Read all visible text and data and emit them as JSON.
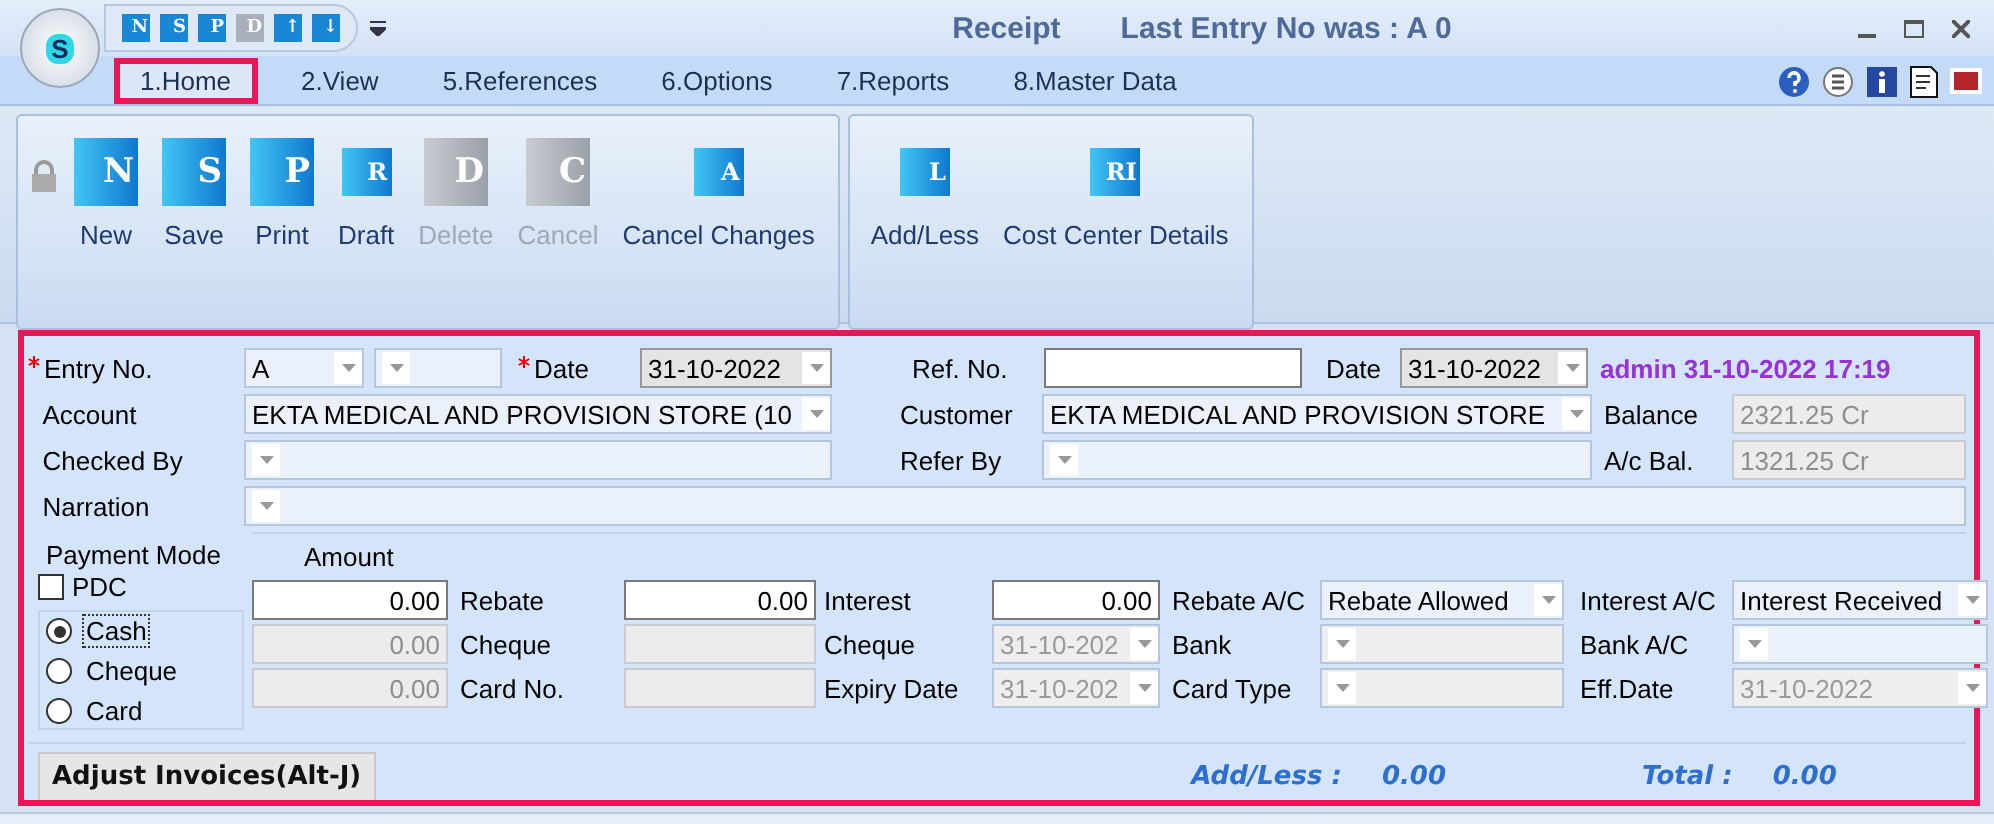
{
  "window": {
    "title": "Receipt",
    "subtitle": "Last Entry No was : A 0",
    "logo_glyph": "S"
  },
  "quick_access": [
    {
      "glyph": "N",
      "disabled": false
    },
    {
      "glyph": "S",
      "disabled": false
    },
    {
      "glyph": "P",
      "disabled": false
    },
    {
      "glyph": "D",
      "disabled": true
    },
    {
      "glyph": "↑",
      "disabled": false
    },
    {
      "glyph": "↓",
      "disabled": false
    }
  ],
  "tabs": [
    {
      "label": "1.Home",
      "selected": true
    },
    {
      "label": "2.View",
      "selected": false
    },
    {
      "label": "5.References",
      "selected": false
    },
    {
      "label": "6.Options",
      "selected": false
    },
    {
      "label": "7.Reports",
      "selected": false
    },
    {
      "label": "8.Master Data",
      "selected": false
    }
  ],
  "ribbon": [
    {
      "locked": true,
      "buttons": [
        {
          "label": "New",
          "glyph": "N",
          "kind": "large",
          "disabled": false
        },
        {
          "label": "Save",
          "glyph": "S",
          "kind": "large",
          "disabled": false
        },
        {
          "label": "Print",
          "glyph": "P",
          "kind": "large",
          "disabled": false
        },
        {
          "label": "Draft",
          "glyph": "R",
          "kind": "small",
          "disabled": false
        },
        {
          "label": "Delete",
          "glyph": "D",
          "kind": "large",
          "disabled": true
        },
        {
          "label": "Cancel",
          "glyph": "C",
          "kind": "large",
          "disabled": true
        },
        {
          "label": "Cancel Changes",
          "glyph": "A",
          "kind": "small",
          "disabled": false
        }
      ]
    },
    {
      "locked": false,
      "buttons": [
        {
          "label": "Add/Less",
          "glyph": "L",
          "kind": "small",
          "disabled": false
        },
        {
          "label": "Cost Center Details",
          "glyph": "RI",
          "kind": "small",
          "disabled": false
        }
      ]
    }
  ],
  "form": {
    "entry_no": {
      "label": "Entry No.",
      "required": true,
      "value": "A"
    },
    "date": {
      "label": "Date",
      "required": true,
      "value": "31-10-2022"
    },
    "ref_no": {
      "label": "Ref. No."
    },
    "ref_date": {
      "label": "Date",
      "value": "31-10-2022"
    },
    "stamp": "admin 31-10-2022 17:19",
    "account": {
      "label": "Account",
      "value": "EKTA MEDICAL AND PROVISION STORE (10"
    },
    "customer": {
      "label": "Customer",
      "value": "EKTA MEDICAL AND PROVISION STORE"
    },
    "balance": {
      "label": "Balance",
      "value": "2321.25 Cr"
    },
    "checked_by": {
      "label": "Checked By"
    },
    "refer_by": {
      "label": "Refer By"
    },
    "ac_bal": {
      "label": "A/c Bal.",
      "value": "1321.25 Cr"
    },
    "narration": {
      "label": "Narration"
    },
    "payment_mode_label": "Payment Mode",
    "amount_label": "Amount",
    "pdc": {
      "label": "PDC",
      "checked": false
    },
    "payment_rows": [
      {
        "mode": "Cash",
        "selected": true,
        "cells": [
          {
            "kind": "field",
            "value": "0.00",
            "disabled": false
          },
          {
            "kind": "label",
            "value": "Rebate"
          },
          {
            "kind": "field",
            "value": "0.00",
            "disabled": false
          },
          {
            "kind": "label",
            "value": "Interest"
          },
          {
            "kind": "field",
            "value": "0.00",
            "disabled": false
          },
          {
            "kind": "label",
            "value": "Rebate A/C"
          },
          {
            "kind": "combo",
            "value": "Rebate Allowed",
            "disabled": false
          },
          {
            "kind": "label",
            "value": "Interest A/C"
          },
          {
            "kind": "combo",
            "value": "Interest Received",
            "disabled": false
          }
        ]
      },
      {
        "mode": "Cheque",
        "selected": false,
        "cells": [
          {
            "kind": "field",
            "value": "0.00",
            "disabled": true
          },
          {
            "kind": "label",
            "value": "Cheque"
          },
          {
            "kind": "field",
            "disabled": true
          },
          {
            "kind": "label",
            "value": "Cheque"
          },
          {
            "kind": "combo",
            "value": "31-10-202",
            "disabled": true
          },
          {
            "kind": "label",
            "value": "Bank"
          },
          {
            "kind": "combo",
            "disabled": true
          },
          {
            "kind": "label",
            "value": "Bank A/C"
          },
          {
            "kind": "combo",
            "disabled": false
          }
        ]
      },
      {
        "mode": "Card",
        "selected": false,
        "cells": [
          {
            "kind": "field",
            "value": "0.00",
            "disabled": true
          },
          {
            "kind": "label",
            "value": "Card No."
          },
          {
            "kind": "field",
            "disabled": true
          },
          {
            "kind": "label",
            "value": "Expiry Date"
          },
          {
            "kind": "combo",
            "value": "31-10-202",
            "disabled": true
          },
          {
            "kind": "label",
            "value": "Card Type"
          },
          {
            "kind": "combo",
            "disabled": true
          },
          {
            "kind": "label",
            "value": "Eff.Date"
          },
          {
            "kind": "combo",
            "value": "31-10-2022",
            "disabled": true
          }
        ]
      }
    ],
    "adjust_button": "Adjust Invoices(Alt-J)",
    "totals": [
      {
        "label": "Add/Less :",
        "value": "0.00"
      },
      {
        "label": "Total :",
        "value": "0.00"
      }
    ]
  }
}
